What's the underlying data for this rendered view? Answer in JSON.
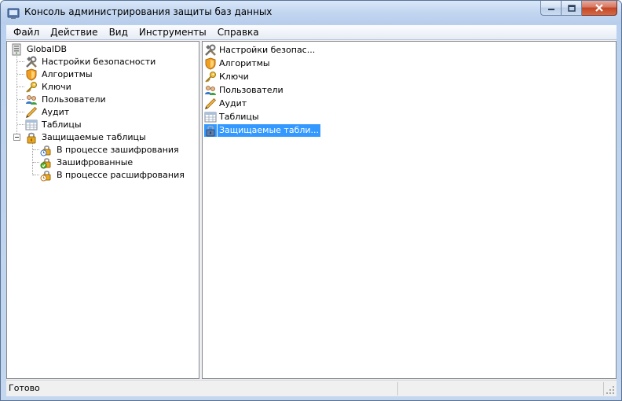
{
  "window": {
    "title": "Консоль администрирования защиты баз данных"
  },
  "menu": [
    "Файл",
    "Действие",
    "Вид",
    "Инструменты",
    "Справка"
  ],
  "tree": {
    "root": {
      "label": "GlobalDB",
      "icon": "server-icon"
    },
    "items": [
      {
        "label": "Настройки безопасности",
        "icon": "tools-icon"
      },
      {
        "label": "Алгоритмы",
        "icon": "shield-icon"
      },
      {
        "label": "Ключи",
        "icon": "key-icon"
      },
      {
        "label": "Пользователи",
        "icon": "users-icon"
      },
      {
        "label": "Аудит",
        "icon": "pencil-icon"
      },
      {
        "label": "Таблицы",
        "icon": "table-icon"
      },
      {
        "label": "Защищаемые таблицы",
        "icon": "lock-icon",
        "expanded": true
      }
    ],
    "children": [
      {
        "label": "В процессе зашифрования",
        "icon": "lock-encrypting-icon"
      },
      {
        "label": "Зашифрованные",
        "icon": "lock-encrypted-icon"
      },
      {
        "label": "В процессе расшифрования",
        "icon": "lock-decrypting-icon"
      }
    ]
  },
  "list": {
    "items": [
      {
        "label": "Настройки безопас...",
        "icon": "tools-icon"
      },
      {
        "label": "Алгоритмы",
        "icon": "shield-icon"
      },
      {
        "label": "Ключи",
        "icon": "key-icon"
      },
      {
        "label": "Пользователи",
        "icon": "users-icon"
      },
      {
        "label": "Аудит",
        "icon": "pencil-icon"
      },
      {
        "label": "Таблицы",
        "icon": "table-icon"
      },
      {
        "label": "Защищаемые табли...",
        "icon": "lock-icon",
        "selected": true
      }
    ]
  },
  "status": {
    "text": "Готово"
  },
  "colors": {
    "selection": "#3399ff",
    "titlebar": "#c2d6f0",
    "close_button": "#c44526"
  }
}
